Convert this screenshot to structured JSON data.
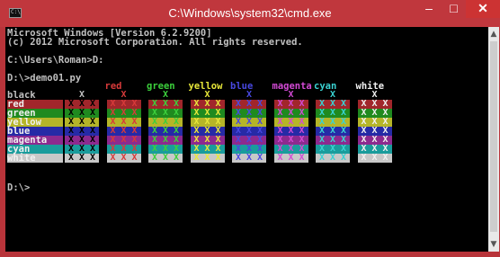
{
  "window": {
    "title": "C:\\Windows\\system32\\cmd.exe",
    "icon_label": "C:\\",
    "min_label": "–",
    "max_label": "□",
    "close_label": "✕"
  },
  "console": {
    "lines": [
      "Microsoft Windows [Version 6.2.9200]",
      "(c) 2012 Microsoft Corporation. All rights reserved.",
      "",
      "C:\\Users\\Roman>D:",
      "",
      "D:\\>demo01.py"
    ],
    "prompt_end": "D:\\>",
    "colors": [
      "black",
      "red",
      "green",
      "yellow",
      "blue",
      "magenta",
      "cyan",
      "white"
    ],
    "cell_text": "X X X",
    "black_row_cell": "X"
  },
  "palette": {
    "black": "#000000",
    "red": "#a1262b",
    "green": "#1f8a1f",
    "yellow": "#b5b528",
    "blue": "#262aa6",
    "magenta": "#8d2a8f",
    "cyan": "#1a9c9c",
    "white": "#c8c8c8"
  },
  "fg_palette": {
    "black": "#404040",
    "red": "#d83a3a",
    "green": "#3ccf3c",
    "yellow": "#e8e83a",
    "blue": "#4848e0",
    "magenta": "#d24ad4",
    "cyan": "#3ad2d2",
    "white": "#f0f0f0"
  }
}
